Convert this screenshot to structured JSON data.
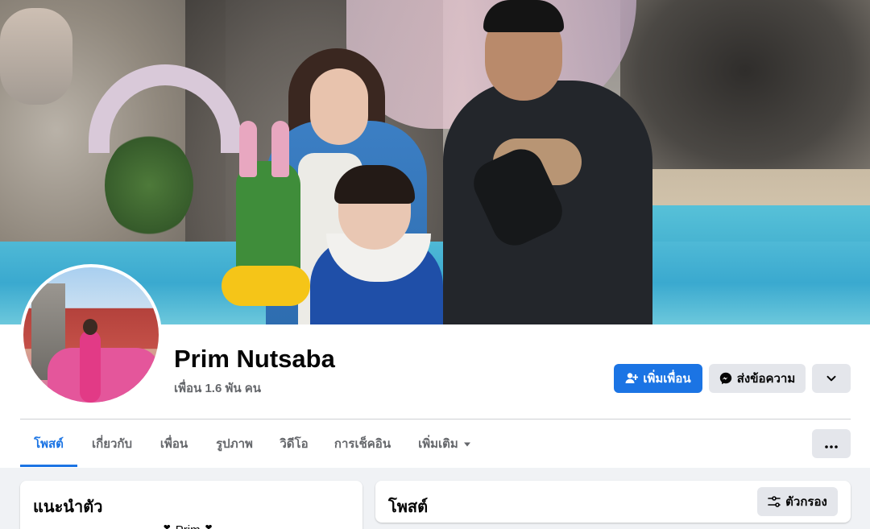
{
  "profile": {
    "name": "Prim Nutsaba",
    "friends": "เพื่อน 1.6 พัน คน"
  },
  "actions": {
    "add_friend": "เพิ่มเพื่อน",
    "message": "ส่งข้อความ"
  },
  "tabs": [
    {
      "label": "โพสต์",
      "active": true
    },
    {
      "label": "เกี่ยวกับ",
      "active": false
    },
    {
      "label": "เพื่อน",
      "active": false
    },
    {
      "label": "รูปภาพ",
      "active": false
    },
    {
      "label": "วิดีโอ",
      "active": false
    },
    {
      "label": "การเช็คอิน",
      "active": false
    },
    {
      "label": "เพิ่มเติม",
      "active": false
    }
  ],
  "intro": {
    "title": "แนะนำตัว",
    "snippet": "❣ Prim ❣"
  },
  "posts": {
    "title": "โพสต์",
    "filter_label": "ตัวกรอง"
  },
  "colors": {
    "accent": "#1b74e4",
    "background": "#f0f2f5",
    "button_gray": "#e4e6eb"
  }
}
